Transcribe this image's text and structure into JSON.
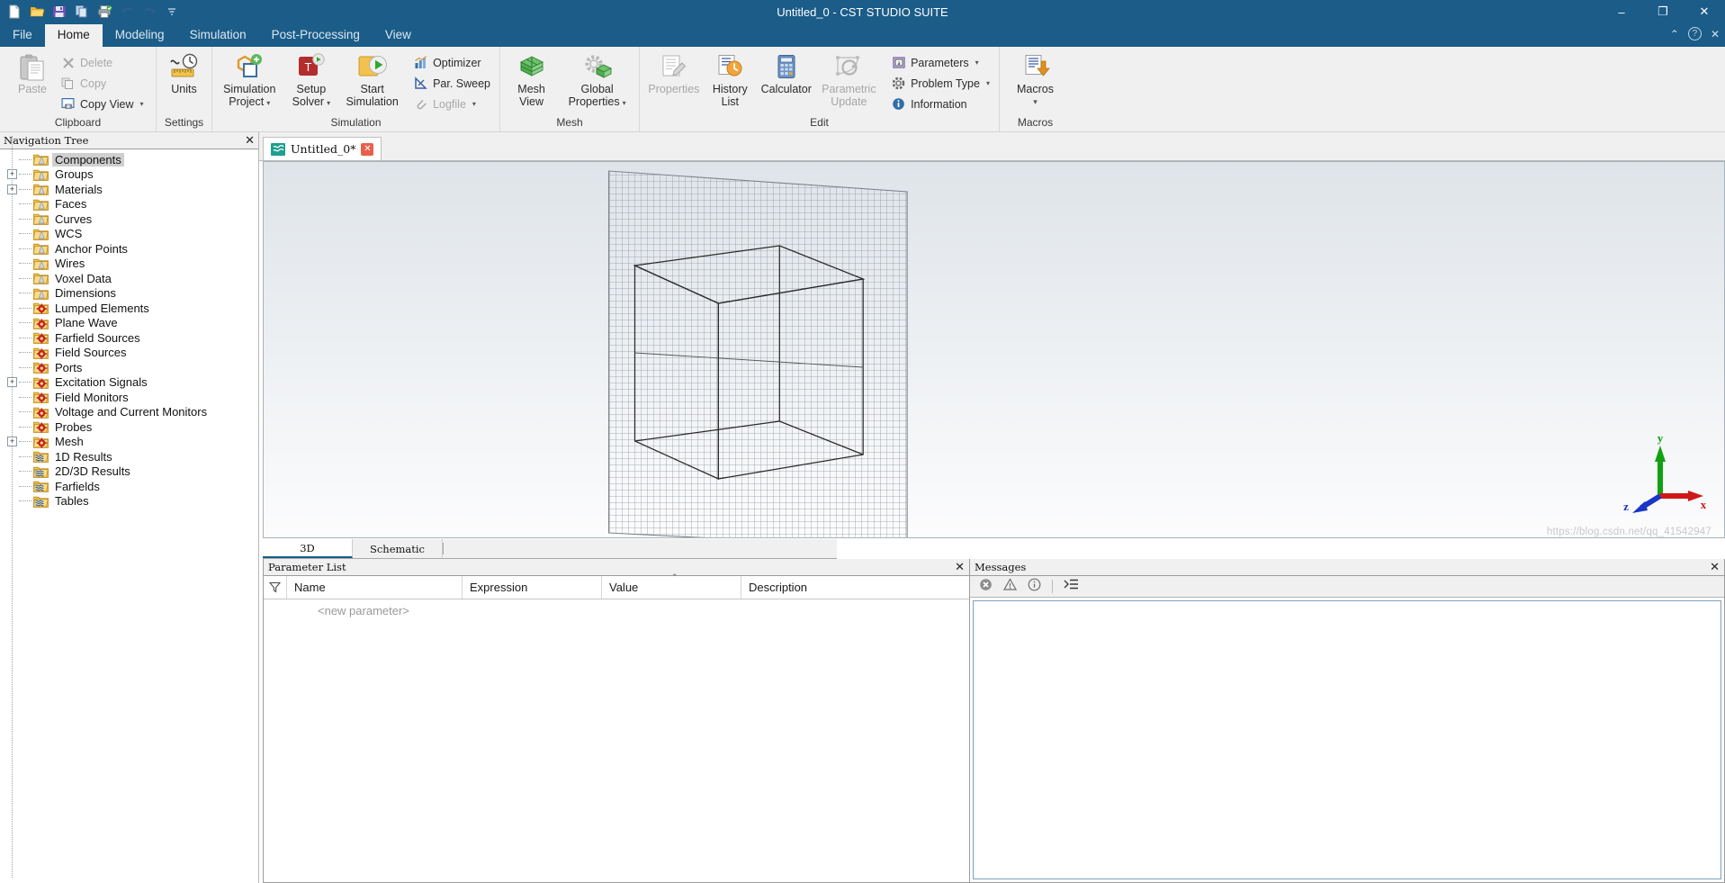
{
  "window": {
    "title": "Untitled_0 - CST STUDIO SUITE",
    "minimize": "–",
    "maximize": "❐",
    "close": "✕"
  },
  "quick_access": [
    {
      "name": "new-document-icon",
      "label": "New"
    },
    {
      "name": "open-folder-icon",
      "label": "Open"
    },
    {
      "name": "save-icon",
      "label": "Save"
    },
    {
      "name": "copy-icon",
      "label": "Copy"
    },
    {
      "name": "print-icon",
      "label": "Print"
    },
    {
      "name": "undo-icon",
      "label": "Undo"
    },
    {
      "name": "redo-icon",
      "label": "Redo"
    },
    {
      "name": "customize-qat-icon",
      "label": "Customize Quick Access Toolbar"
    }
  ],
  "ribbon_tabs": [
    {
      "label": "File",
      "active": false
    },
    {
      "label": "Home",
      "active": true
    },
    {
      "label": "Modeling",
      "active": false
    },
    {
      "label": "Simulation",
      "active": false
    },
    {
      "label": "Post-Processing",
      "active": false
    },
    {
      "label": "View",
      "active": false
    }
  ],
  "ribbon_right": {
    "collapse": "⌃",
    "help": "?",
    "close": "✕"
  },
  "ribbon_groups": [
    {
      "label": "Clipboard",
      "big": [
        {
          "label": "Paste",
          "icon": "paste-icon",
          "disabled": true,
          "caret": ""
        }
      ],
      "small": [
        {
          "label": "Delete",
          "icon": "delete-icon",
          "disabled": true,
          "caret": ""
        },
        {
          "label": "Copy",
          "icon": "copy-icon",
          "disabled": true,
          "caret": ""
        },
        {
          "label": "Copy View",
          "icon": "copy-view-icon",
          "disabled": false,
          "caret": "▾"
        }
      ]
    },
    {
      "label": "Settings",
      "big": [
        {
          "label": "Units",
          "icon": "units-icon",
          "disabled": false,
          "caret": ""
        }
      ],
      "small": []
    },
    {
      "label": "Simulation",
      "big": [
        {
          "label": "Simulation\nProject",
          "icon": "simulation-project-icon",
          "disabled": false,
          "caret": "▾"
        },
        {
          "label": "Setup\nSolver",
          "icon": "setup-solver-icon",
          "disabled": false,
          "caret": "▾"
        },
        {
          "label": "Start\nSimulation",
          "icon": "start-simulation-icon",
          "disabled": false,
          "caret": ""
        }
      ],
      "small": [
        {
          "label": "Optimizer",
          "icon": "optimizer-icon",
          "disabled": false,
          "caret": ""
        },
        {
          "label": "Par. Sweep",
          "icon": "par-sweep-icon",
          "disabled": false,
          "caret": ""
        },
        {
          "label": "Logfile",
          "icon": "logfile-icon",
          "disabled": true,
          "caret": "▾"
        }
      ]
    },
    {
      "label": "Mesh",
      "big": [
        {
          "label": "Mesh\nView",
          "icon": "mesh-view-icon",
          "disabled": false,
          "caret": ""
        },
        {
          "label": "Global\nProperties",
          "icon": "global-properties-icon",
          "disabled": false,
          "caret": "▾"
        }
      ],
      "small": []
    },
    {
      "label": "Edit",
      "big": [
        {
          "label": "Properties",
          "icon": "properties-icon",
          "disabled": true,
          "caret": ""
        },
        {
          "label": "History\nList",
          "icon": "history-list-icon",
          "disabled": false,
          "caret": ""
        },
        {
          "label": "Calculator",
          "icon": "calculator-icon",
          "disabled": false,
          "caret": ""
        },
        {
          "label": "Parametric\nUpdate",
          "icon": "parametric-update-icon",
          "disabled": true,
          "caret": ""
        }
      ],
      "small": [
        {
          "label": "Parameters",
          "icon": "parameters-icon",
          "disabled": false,
          "caret": "▾"
        },
        {
          "label": "Problem Type",
          "icon": "problem-type-icon",
          "disabled": false,
          "caret": "▾"
        },
        {
          "label": "Information",
          "icon": "information-icon",
          "disabled": false,
          "caret": ""
        }
      ]
    },
    {
      "label": "Macros",
      "big": [
        {
          "label": "Macros",
          "icon": "macros-icon",
          "disabled": false,
          "caret": "▾"
        }
      ],
      "small": []
    }
  ],
  "navigation": {
    "title": "Navigation Tree",
    "close": "✕",
    "items": [
      {
        "label": "Components",
        "icon": "folder-shape-icon",
        "expander": "",
        "selected": true
      },
      {
        "label": "Groups",
        "icon": "folder-shape-icon",
        "expander": "+",
        "selected": false
      },
      {
        "label": "Materials",
        "icon": "folder-shape-icon",
        "expander": "+",
        "selected": false
      },
      {
        "label": "Faces",
        "icon": "folder-shape-icon",
        "expander": "",
        "selected": false
      },
      {
        "label": "Curves",
        "icon": "folder-shape-icon",
        "expander": "",
        "selected": false
      },
      {
        "label": "WCS",
        "icon": "folder-shape-icon",
        "expander": "",
        "selected": false
      },
      {
        "label": "Anchor Points",
        "icon": "folder-shape-icon",
        "expander": "",
        "selected": false
      },
      {
        "label": "Wires",
        "icon": "folder-shape-icon",
        "expander": "",
        "selected": false
      },
      {
        "label": "Voxel Data",
        "icon": "folder-shape-icon",
        "expander": "",
        "selected": false
      },
      {
        "label": "Dimensions",
        "icon": "folder-shape-icon",
        "expander": "",
        "selected": false
      },
      {
        "label": "Lumped Elements",
        "icon": "folder-gear-icon",
        "expander": "",
        "selected": false
      },
      {
        "label": "Plane Wave",
        "icon": "folder-gear-icon",
        "expander": "",
        "selected": false
      },
      {
        "label": "Farfield Sources",
        "icon": "folder-gear-icon",
        "expander": "",
        "selected": false
      },
      {
        "label": "Field Sources",
        "icon": "folder-gear-icon",
        "expander": "",
        "selected": false
      },
      {
        "label": "Ports",
        "icon": "folder-gear-icon",
        "expander": "",
        "selected": false
      },
      {
        "label": "Excitation Signals",
        "icon": "folder-gear-icon",
        "expander": "+",
        "selected": false
      },
      {
        "label": "Field Monitors",
        "icon": "folder-gear-icon",
        "expander": "",
        "selected": false
      },
      {
        "label": "Voltage and Current Monitors",
        "icon": "folder-gear-icon",
        "expander": "",
        "selected": false
      },
      {
        "label": "Probes",
        "icon": "folder-gear-icon",
        "expander": "",
        "selected": false
      },
      {
        "label": "Mesh",
        "icon": "folder-gear-icon",
        "expander": "+",
        "selected": false
      },
      {
        "label": "1D Results",
        "icon": "folder-result-icon",
        "expander": "",
        "selected": false
      },
      {
        "label": "2D/3D Results",
        "icon": "folder-result-icon",
        "expander": "",
        "selected": false
      },
      {
        "label": "Farfields",
        "icon": "folder-result-icon",
        "expander": "",
        "selected": false
      },
      {
        "label": "Tables",
        "icon": "folder-result-icon",
        "expander": "",
        "selected": false
      }
    ]
  },
  "document_tab": {
    "label": "Untitled_0*",
    "close": "✕"
  },
  "viewport": {
    "axis": {
      "x": "x",
      "y": "y",
      "z": "z"
    },
    "watermark": "https://blog.csdn.net/qq_41542947"
  },
  "view_tabs": [
    {
      "label": "3D",
      "active": true
    },
    {
      "label": "Schematic",
      "active": false
    }
  ],
  "parameter_list": {
    "title": "Parameter List",
    "close": "✕",
    "columns": [
      "Name",
      "Expression",
      "Value",
      "Description"
    ],
    "rows": [],
    "new_row_placeholder": "<new parameter>"
  },
  "messages": {
    "title": "Messages",
    "close": "✕",
    "toolbar": [
      {
        "name": "errors-icon",
        "label": "Errors"
      },
      {
        "name": "warnings-icon",
        "label": "Warnings"
      },
      {
        "name": "info-icon",
        "label": "Information"
      },
      {
        "name": "clear-messages-icon",
        "label": "Clear"
      }
    ],
    "body_text": ""
  },
  "colors": {
    "titlebar": "#1b5c88",
    "ribbon_bg": "#f0f0f0",
    "accent": "#1b5c88",
    "axis_x": "#d01818",
    "axis_y": "#12a012",
    "axis_z": "#1a35c8"
  }
}
